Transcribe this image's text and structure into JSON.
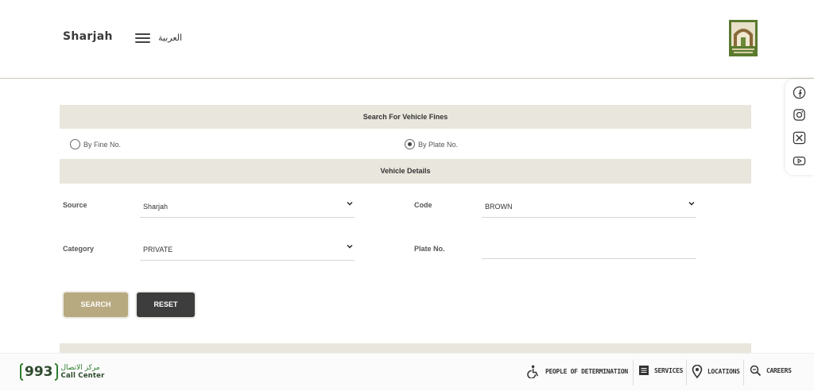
{
  "header": {
    "brand": "Sharjah",
    "language_link": "العربية",
    "menu_icon": "hamburger-icon",
    "logo": "sharjah-municipality-logo"
  },
  "social": [
    {
      "name": "facebook-icon"
    },
    {
      "name": "instagram-icon"
    },
    {
      "name": "x-icon"
    },
    {
      "name": "youtube-icon"
    }
  ],
  "form": {
    "section_title": "Search For Vehicle Fines",
    "search_options": [
      {
        "label": "By Fine No.",
        "selected": false
      },
      {
        "label": "By Plate No.",
        "selected": true
      }
    ],
    "details_title": "Vehicle Details",
    "source_label": "Source",
    "source_value": "Sharjah",
    "code_label": "Code",
    "code_value": "BROWN",
    "category_label": "Category",
    "category_value": "PRIVATE",
    "plate_label": "Plate No.",
    "plate_value": "",
    "search_button": "SEARCH",
    "reset_button": "RESET"
  },
  "footer": {
    "call_center_number": "993",
    "call_center_arabic": "مركز الاتصال",
    "call_center_label": "Call Center",
    "links": [
      {
        "label": "PEOPLE OF DETERMINATION",
        "icon": "wheelchair-icon"
      },
      {
        "label": "SERVICES",
        "icon": "list-icon"
      },
      {
        "label": "LOCATIONS",
        "icon": "location-pin-icon"
      },
      {
        "label": "CAREERS",
        "icon": "search-careers-icon"
      }
    ]
  },
  "colors": {
    "accent_gold": "#b8aa80",
    "dark_button": "#3d3d3d",
    "section_bar": "#e9e6dd",
    "brand_green": "#2e7d2e"
  }
}
